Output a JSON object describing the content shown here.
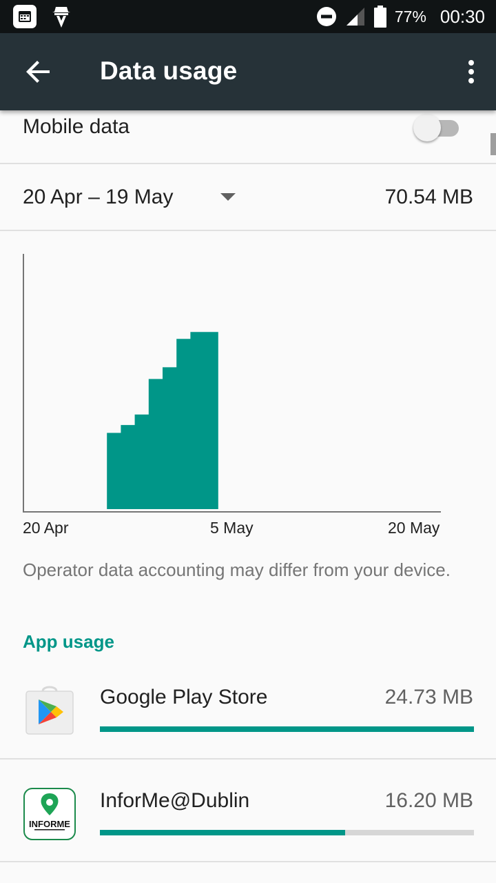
{
  "status_bar": {
    "battery_percent": "77%",
    "time": "00:30",
    "icons": [
      "calendar-icon",
      "incognito-icon",
      "do-not-disturb-icon",
      "signal-icon",
      "battery-icon"
    ]
  },
  "app_bar": {
    "title": "Data usage",
    "back_icon": "arrow-back-icon",
    "overflow_icon": "more-vert-icon"
  },
  "mobile_data": {
    "label": "Mobile data",
    "enabled": false
  },
  "cycle": {
    "range": "20 Apr – 19 May",
    "total": "70.54 MB"
  },
  "chart_data": {
    "type": "area",
    "x_unit": "day (date)",
    "x_ticks": [
      "20 Apr",
      "5 May",
      "20 May"
    ],
    "x_range": [
      "20 Apr",
      "20 May"
    ],
    "y_unit": "MB",
    "y_range": [
      0,
      70.54
    ],
    "grid": false,
    "color": "#009688",
    "series": [
      {
        "points": [
          [
            "25 Apr",
            0
          ],
          [
            "26 Apr",
            25.3
          ],
          [
            "27 Apr",
            27.9
          ],
          [
            "28 Apr",
            31.4
          ],
          [
            "29 Apr",
            43.2
          ],
          [
            "30 Apr",
            47.1
          ],
          [
            "1 May",
            56.5
          ],
          [
            "2 May",
            58.8
          ],
          [
            "3 May",
            58.8
          ],
          [
            "4 May",
            70.5
          ],
          [
            "4 May",
            0
          ]
        ]
      }
    ]
  },
  "note": "Operator data accounting may differ from your device.",
  "app_usage": {
    "title": "App usage",
    "apps": [
      {
        "name": "Google Play Store",
        "usage": "24.73 MB",
        "fraction": 1.0,
        "icon": "google-play-store-icon"
      },
      {
        "name": "InforMe@Dublin",
        "usage": "16.20 MB",
        "fraction": 0.655,
        "icon": "informe-dublin-icon",
        "icon_text": "INFORME"
      }
    ]
  }
}
